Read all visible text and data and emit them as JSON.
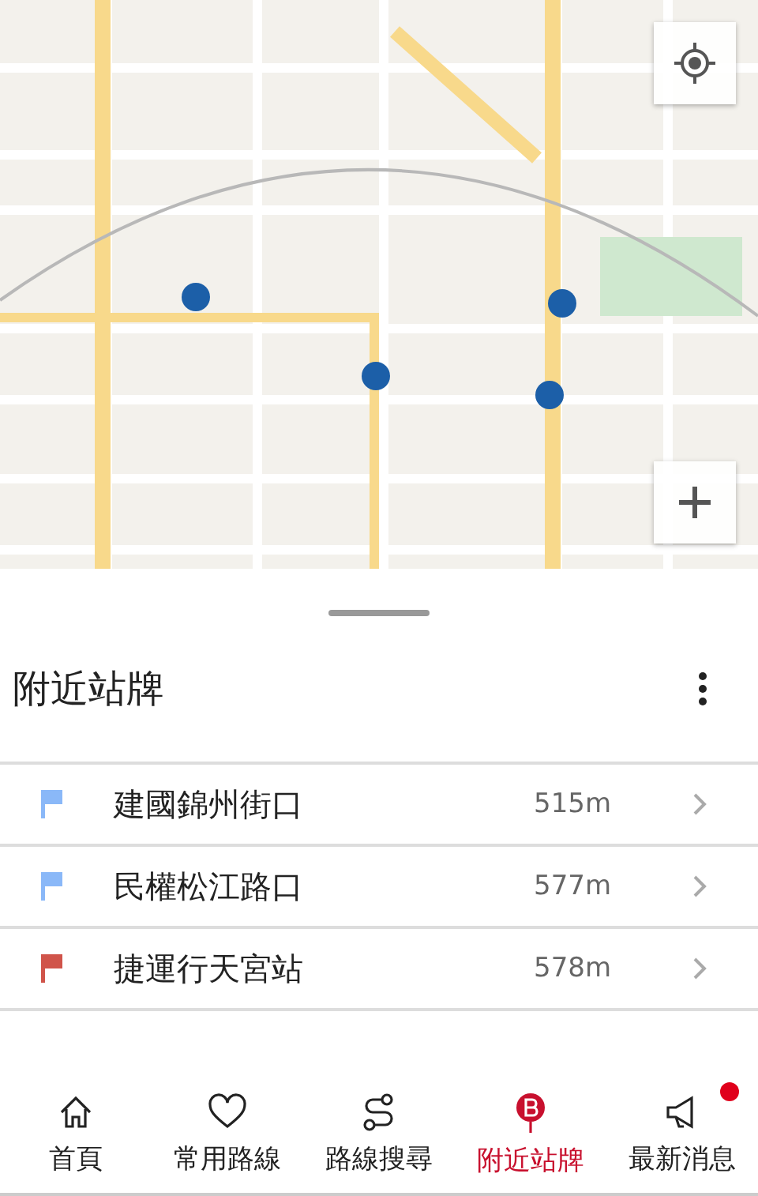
{
  "sheet": {
    "title": "附近站牌"
  },
  "stops": [
    {
      "name": "建國錦州街口",
      "distance": "515m",
      "color": "#8ab8f8"
    },
    {
      "name": "民權松江路口",
      "distance": "577m",
      "color": "#8ab8f8"
    },
    {
      "name": "捷運行天宮站",
      "distance": "578m",
      "color": "#d0544a"
    }
  ],
  "nav": [
    {
      "kind": "home",
      "label": "首頁",
      "selected": false,
      "badge": false
    },
    {
      "kind": "heart",
      "label": "常用路線",
      "selected": false,
      "badge": false
    },
    {
      "kind": "route",
      "label": "路線搜尋",
      "selected": false,
      "badge": false
    },
    {
      "kind": "stop",
      "label": "附近站牌",
      "selected": true,
      "badge": false
    },
    {
      "kind": "news",
      "label": "最新消息",
      "selected": false,
      "badge": true
    }
  ]
}
